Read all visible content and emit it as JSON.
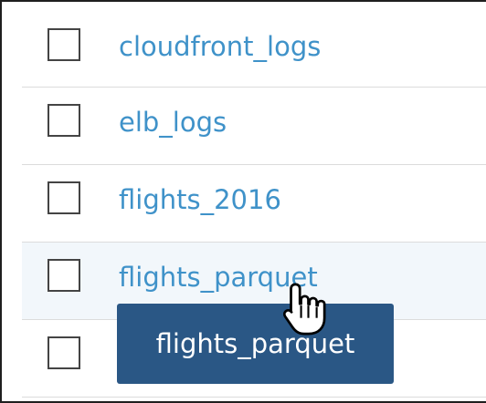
{
  "tables": [
    {
      "name": "cloudfront_logs",
      "hovered": false
    },
    {
      "name": "elb_logs",
      "hovered": false
    },
    {
      "name": "flights_2016",
      "hovered": false
    },
    {
      "name": "flights_parquet",
      "hovered": true
    },
    {
      "name": "",
      "hovered": false
    }
  ],
  "tooltip": {
    "text": "flights_parquet"
  },
  "colors": {
    "link": "#3f92c9",
    "tooltip_bg": "#2a5785",
    "hover_row": "#f2f7fb",
    "divider": "#dcdcdc"
  },
  "cursor": {
    "icon": "hand-pointer-icon"
  }
}
